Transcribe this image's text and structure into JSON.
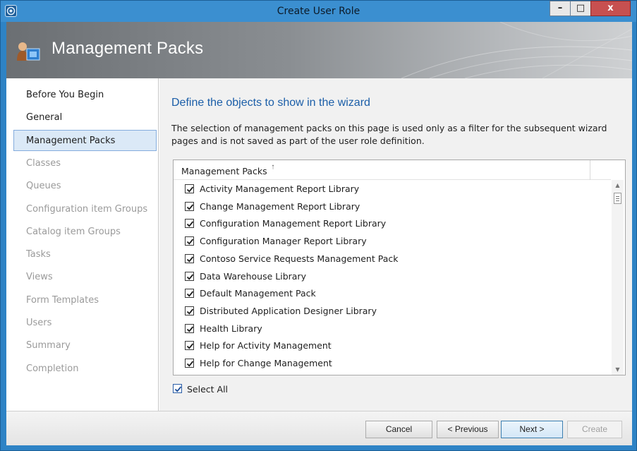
{
  "window": {
    "title": "Create User Role"
  },
  "title_buttons": {
    "minimize": "–",
    "maximize": "□",
    "close": "x"
  },
  "banner": {
    "title": "Management Packs",
    "icon": "user-role-icon"
  },
  "nav": {
    "items": [
      {
        "label": "Before You Begin",
        "state": "done"
      },
      {
        "label": "General",
        "state": "done"
      },
      {
        "label": "Management Packs",
        "state": "active"
      },
      {
        "label": "Classes",
        "state": "pending"
      },
      {
        "label": "Queues",
        "state": "pending"
      },
      {
        "label": "Configuration item Groups",
        "state": "pending"
      },
      {
        "label": "Catalog item Groups",
        "state": "pending"
      },
      {
        "label": "Tasks",
        "state": "pending"
      },
      {
        "label": "Views",
        "state": "pending"
      },
      {
        "label": "Form Templates",
        "state": "pending"
      },
      {
        "label": "Users",
        "state": "pending"
      },
      {
        "label": "Summary",
        "state": "pending"
      },
      {
        "label": "Completion",
        "state": "pending"
      }
    ]
  },
  "main": {
    "heading": "Define the objects to show in the wizard",
    "description": "The selection of management packs on this page is used only as a filter for the subsequent wizard pages and is not saved as part of the user role definition.",
    "list": {
      "column_header": "Management Packs",
      "sort_indicator": "⭡",
      "rows": [
        {
          "label": "Activity Management Report Library",
          "checked": true
        },
        {
          "label": "Change Management Report Library",
          "checked": true
        },
        {
          "label": "Configuration Management Report Library",
          "checked": true
        },
        {
          "label": "Configuration Manager Report Library",
          "checked": true
        },
        {
          "label": "Contoso Service Requests Management Pack",
          "checked": true
        },
        {
          "label": "Data Warehouse Library",
          "checked": true
        },
        {
          "label": "Default Management Pack",
          "checked": true
        },
        {
          "label": "Distributed Application Designer Library",
          "checked": true
        },
        {
          "label": "Health Library",
          "checked": true
        },
        {
          "label": "Help for Activity Management",
          "checked": true
        },
        {
          "label": "Help for Change Management",
          "checked": true
        }
      ]
    },
    "select_all": {
      "label": "Select All",
      "checked": true
    }
  },
  "footer": {
    "cancel": "Cancel",
    "previous": "< Previous",
    "next": "Next >",
    "create": "Create"
  },
  "colors": {
    "accent": "#1b5ea8",
    "titlebar": "#3b8fd0",
    "close_button": "#c75050",
    "nav_active_bg": "#dbe9f7"
  }
}
